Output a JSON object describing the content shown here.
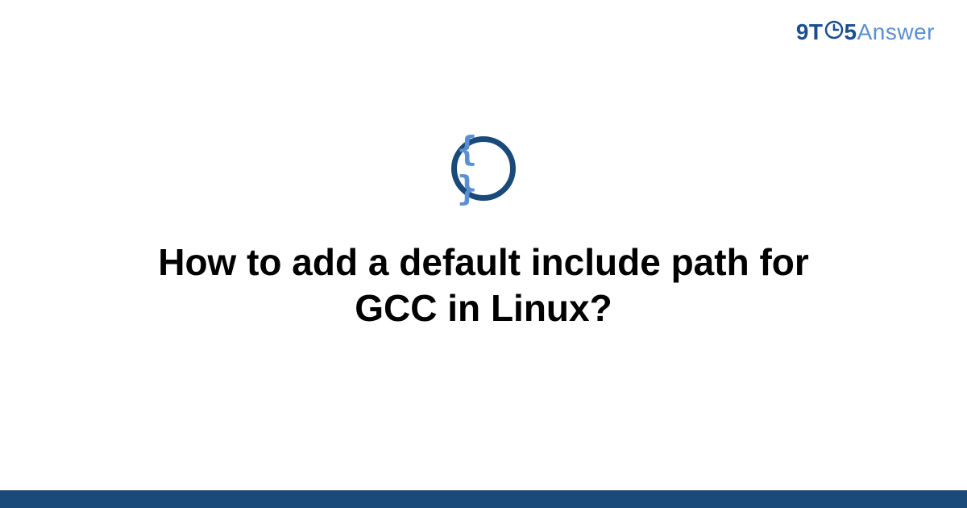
{
  "header": {
    "logo_prefix": "9T",
    "logo_middle": "5",
    "logo_suffix": "Answer"
  },
  "main": {
    "icon_name": "curly-braces-icon",
    "braces_glyph": "{ }",
    "title": "How to add a default include path for GCC in Linux?"
  },
  "colors": {
    "brand_dark": "#1a4a7a",
    "brand_light": "#5a8fd4",
    "text": "#000000"
  }
}
